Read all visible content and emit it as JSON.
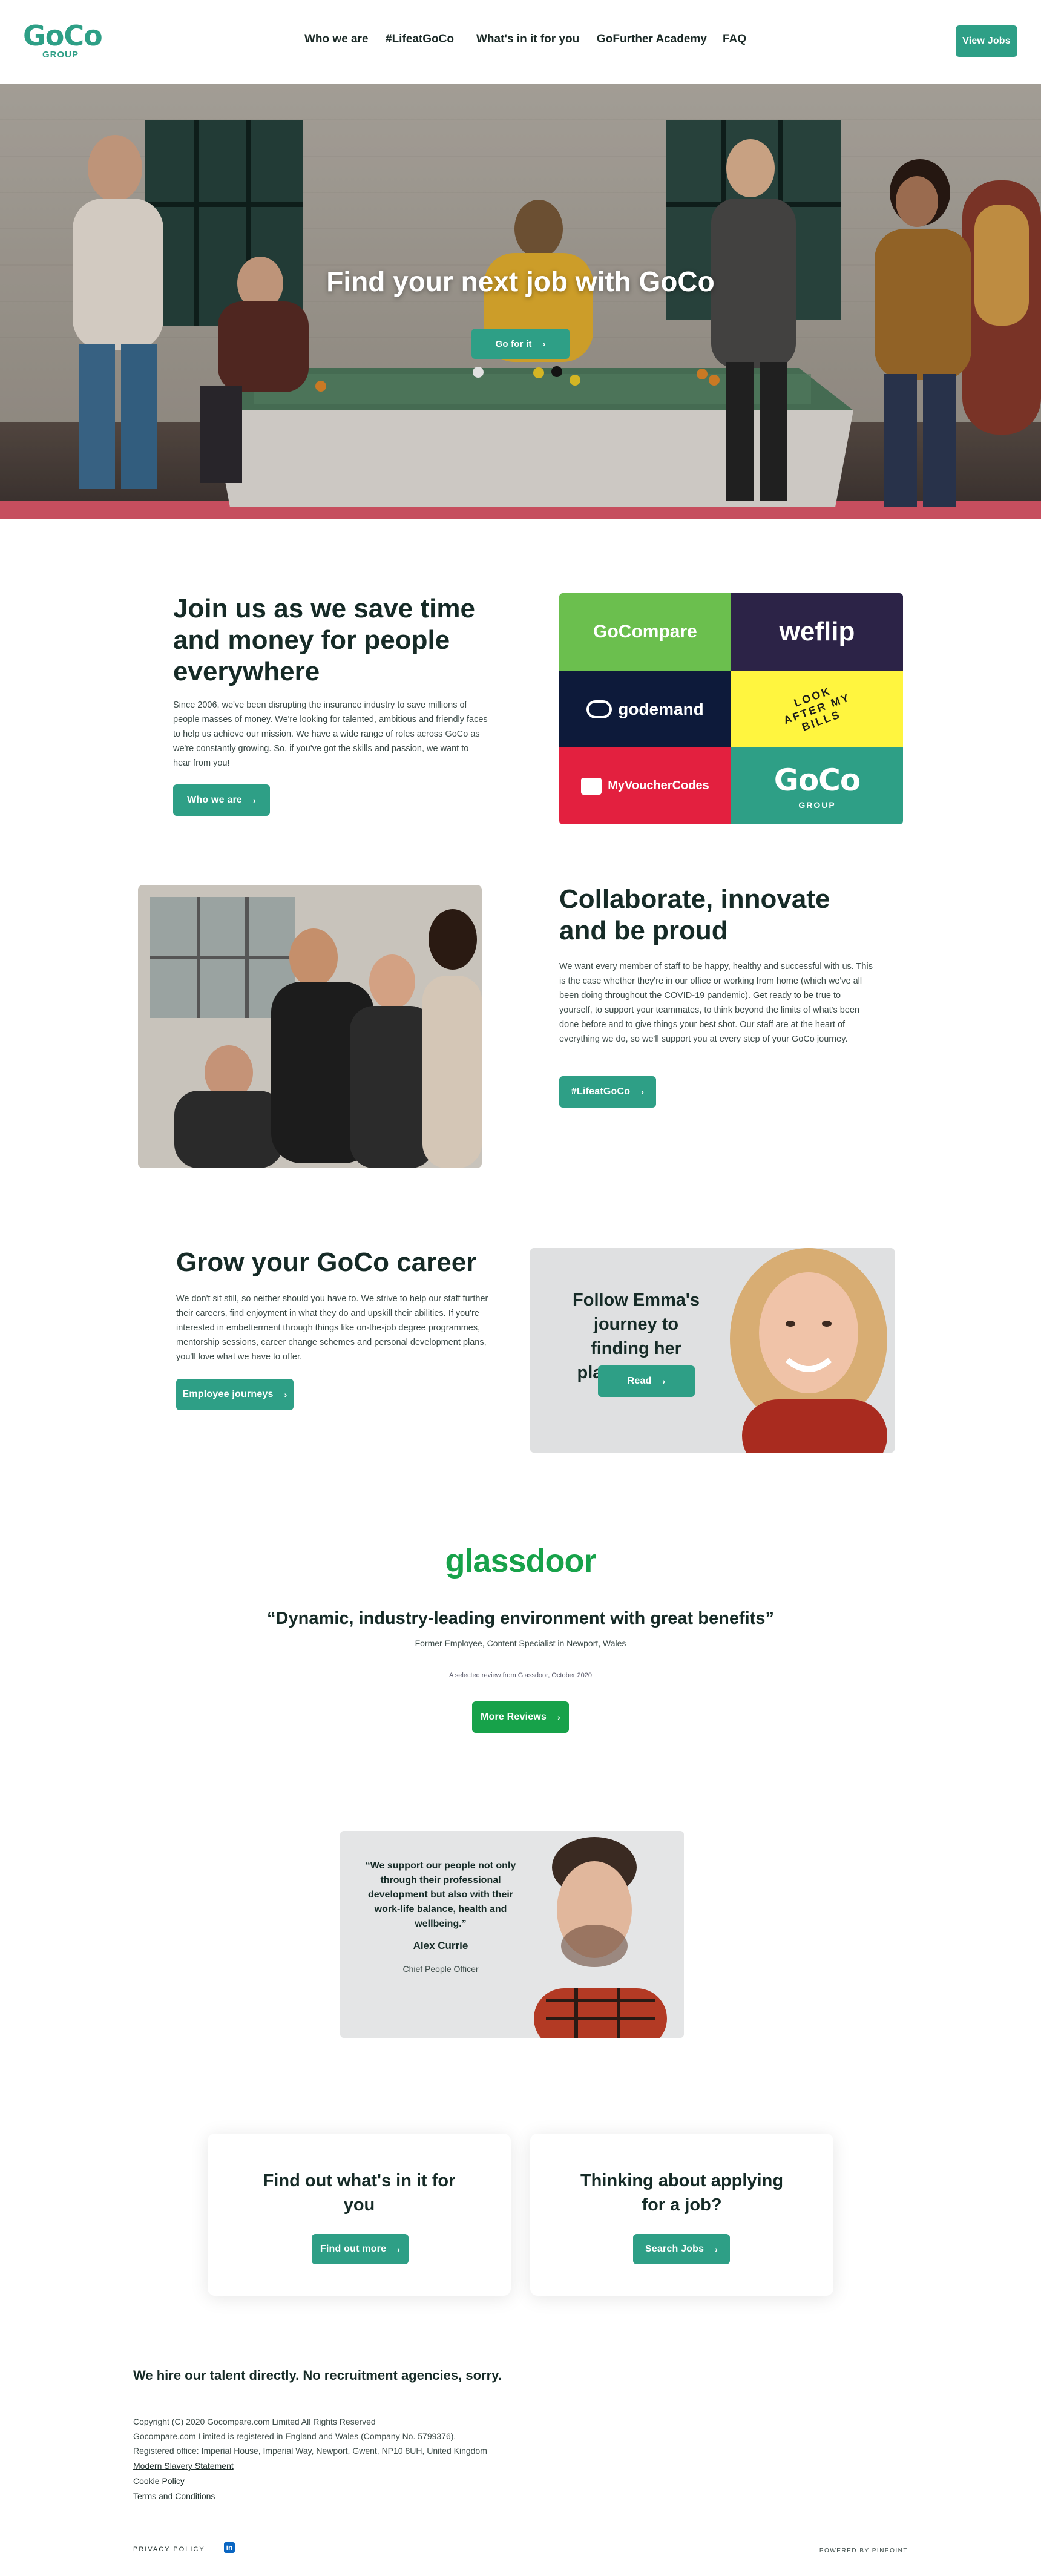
{
  "header": {
    "logo_text": "GoCo",
    "logo_sub": "GROUP",
    "nav": [
      "Who we are",
      "#LifeatGoCo",
      "What's in it for you",
      "GoFurther Academy",
      "FAQ"
    ],
    "cta": "View Jobs"
  },
  "hero": {
    "title": "Find your next job with GoCo",
    "button": "Go for it"
  },
  "join": {
    "title": "Join us as we save time and money for people everywhere",
    "body": "Since 2006, we've been disrupting the insurance industry to save millions of people masses of money. We're looking for talented, ambitious and friendly faces to help us achieve our mission. We have a wide range of roles across GoCo as we're constantly growing. So, if you've got the skills and passion, we want to hear from you!",
    "button": "Who we are",
    "brands": [
      {
        "name": "GoCompare",
        "color": "#6bbf4e"
      },
      {
        "name": "weflip",
        "color": "#2c2347"
      },
      {
        "name": "godemand",
        "color": "#0d1a3a"
      },
      {
        "name": "LOOK AFTER MY BILLS",
        "color": "#fff53f"
      },
      {
        "name": "MyVoucherCodes",
        "color": "#e3203f"
      },
      {
        "name": "GoCo",
        "color": "#2e9f86"
      }
    ],
    "brand_sub": "GROUP"
  },
  "collab": {
    "title": "Collaborate, innovate and be proud",
    "body": "We want every member of staff to be happy, healthy and successful with us. This is the case whether they're in our office or working from home (which we've all been doing throughout the COVID-19 pandemic). Get ready to be true to yourself, to support your teammates, to think beyond the limits of what's been done before and to give things your best shot. Our staff are at the heart of everything we do, so we'll support you at every step of your GoCo journey.",
    "button": "#LifeatGoCo"
  },
  "career": {
    "title": "Grow your GoCo career",
    "body": "We don't sit still, so neither should you have to. We strive to help our staff further their careers, find enjoyment in what they do and upskill their abilities. If you're interested in embetterment through things like on-the-job degree programmes, mentorship sessions, career change schemes and personal development plans, you'll love what we have to offer.",
    "button": "Employee journeys",
    "promo_title": "Follow Emma's journey to finding her place at GoCo",
    "promo_button": "Read"
  },
  "glassdoor": {
    "logo": "glassdoor",
    "quote": "“Dynamic, industry-leading environment with great benefits”",
    "author": "Former Employee, Content Specialist in Newport, Wales",
    "note": "A selected review from Glassdoor, October 2020",
    "button": "More Reviews"
  },
  "testimonial": {
    "quote": "“We support our people not only through their professional development but also with their work-life balance, health and wellbeing.”",
    "name": "Alex Currie",
    "role": "Chief People Officer"
  },
  "cards": [
    {
      "title": "Find out what's in it for you",
      "button": "Find out more"
    },
    {
      "title": "Thinking about applying for a job?",
      "button": "Search Jobs"
    }
  ],
  "footer": {
    "headline": "We hire our talent directly. No recruitment agencies, sorry.",
    "lines": [
      "Copyright (C) 2020 Gocompare.com Limited All Rights Reserved",
      "Gocompare.com Limited is registered in England and Wales (Company No. 5799376).",
      "Registered office: Imperial House, Imperial Way, Newport, Gwent, NP10 8UH, United Kingdom"
    ],
    "links": [
      "Modern Slavery Statement",
      "Cookie Policy",
      "Terms and Conditions"
    ],
    "privacy": "PRIVACY POLICY",
    "social": "in",
    "powered": "POWERED BY PINPOINT"
  },
  "colors": {
    "primary": "#2e9f86",
    "glassdoor_green": "#17a24a",
    "heading": "#162b27"
  }
}
